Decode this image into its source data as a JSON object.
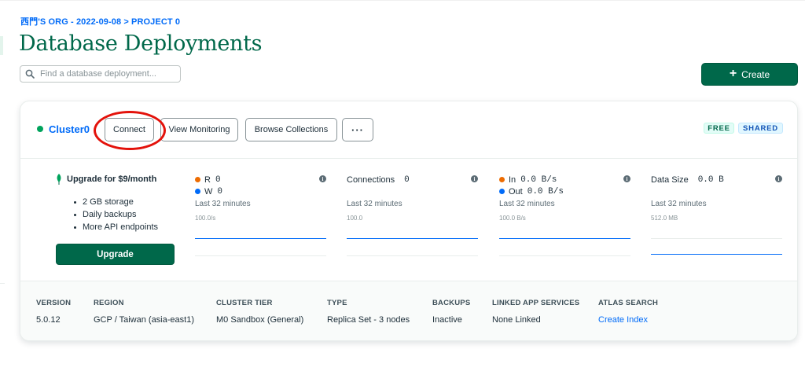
{
  "breadcrumb": "西門'S ORG - 2022-09-08 > PROJECT 0",
  "page_title": "Database Deployments",
  "search": {
    "placeholder": "Find a database deployment..."
  },
  "create_button": {
    "label": "Create",
    "icon": "plus-icon"
  },
  "cluster": {
    "name": "Cluster0",
    "status_color": "#00a35c",
    "buttons": {
      "connect": "Connect",
      "view_monitoring": "View Monitoring",
      "browse_collections": "Browse Collections",
      "more": "···"
    },
    "badges": {
      "free": "FREE",
      "shared": "SHARED"
    },
    "upgrade": {
      "title": "Upgrade for $9/month",
      "features": [
        "2 GB storage",
        "Daily backups",
        "More API endpoints"
      ],
      "button": "Upgrade"
    },
    "metrics": [
      {
        "rows": [
          {
            "label": "R",
            "value": "0",
            "color": "#ed6c02"
          },
          {
            "label": "W",
            "value": "0",
            "color": "#016bf8"
          }
        ],
        "subtitle": "Last 32 minutes",
        "scale": "100.0/s"
      },
      {
        "label": "Connections",
        "value": "0",
        "subtitle": "Last 32 minutes",
        "scale": "100.0"
      },
      {
        "rows": [
          {
            "label": "In",
            "value": "0.0 B/s",
            "color": "#ed6c02"
          },
          {
            "label": "Out",
            "value": "0.0 B/s",
            "color": "#016bf8"
          }
        ],
        "subtitle": "Last 32 minutes",
        "scale": "100.0 B/s"
      },
      {
        "label": "Data Size",
        "value": "0.0 B",
        "subtitle": "Last 32 minutes",
        "scale": "512.0 MB"
      }
    ],
    "details": {
      "version": {
        "label": "VERSION",
        "value": "5.0.12"
      },
      "region": {
        "label": "REGION",
        "value": "GCP / Taiwan (asia-east1)"
      },
      "cluster_tier": {
        "label": "CLUSTER TIER",
        "value": "M0 Sandbox (General)"
      },
      "type": {
        "label": "TYPE",
        "value": "Replica Set - 3 nodes"
      },
      "backups": {
        "label": "BACKUPS",
        "value": "Inactive"
      },
      "linked_app_services": {
        "label": "LINKED APP SERVICES",
        "value": "None Linked"
      },
      "atlas_search": {
        "label": "ATLAS SEARCH",
        "value": "Create Index"
      }
    }
  },
  "colors": {
    "brand_green": "#00684a",
    "link_blue": "#016bf8",
    "highlight_red": "#e3120b"
  }
}
